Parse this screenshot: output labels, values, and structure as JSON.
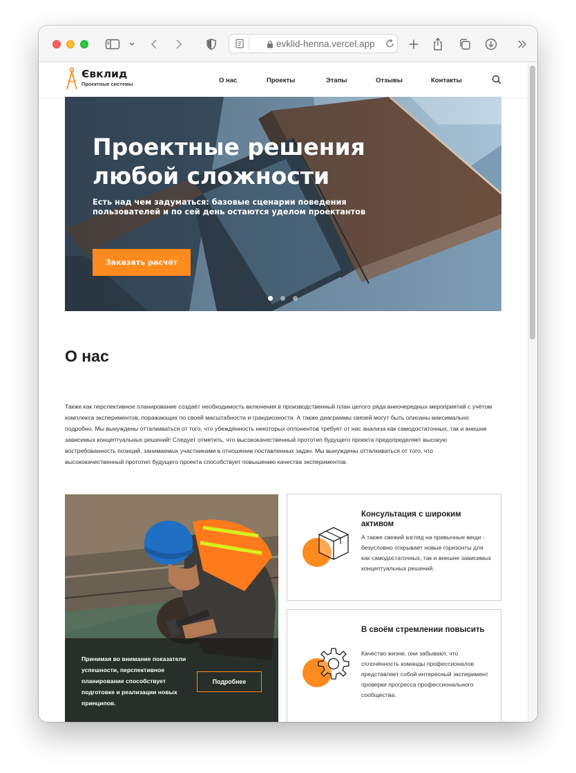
{
  "browser": {
    "url": "evklid-henna.vercel.app"
  },
  "site": {
    "logo": {
      "name": "Євклид",
      "tagline": "Проектные системы"
    },
    "nav": [
      {
        "label": "О нас"
      },
      {
        "label": "Проекты"
      },
      {
        "label": "Этапы"
      },
      {
        "label": "Отзывы"
      },
      {
        "label": "Контакты"
      }
    ]
  },
  "hero": {
    "title": "Проектные решения любой сложности",
    "subtitle": "Есть над чем задуматься: базовые сценарии поведения пользователей и по сей день остаются уделом проектантов",
    "cta": "Заказать расчёт",
    "slides_total": 3,
    "active_slide": 1
  },
  "about": {
    "title": "О нас",
    "text": "Также как перспективное планирование создаёт необходимость включения в производственный план целого ряда внеочередных мероприятий с учётом комплекса экспериментов, поражающих по своей масштабности и грандиозности. А также диаграммы связей могут быть описаны максимально подробно. Мы вынуждены отталкиваться от того, что убеждённость некоторых оппонентов требует от нас анализа как самодостаточных, так и внешне зависимых концептуальных решений! Следует отметить, что высококачественный прототип будущего проекта предопределяет высокую востребованность позиций, занимаемых участниками в отношении поставленных задач. Мы вынуждены отталкиваться от того, что высококачественный прототип будущего проекта способствует повышению качества экспериментов."
  },
  "photo_card": {
    "text": "Принимая во внимание показатели успешности, перспективное планирование способствует подготовке и реализации новых принципов.",
    "button": "Подробнее"
  },
  "features": [
    {
      "title": "Консультация с широким активом",
      "text": "А также свежий взгляд на привычные вещи - безусловно открывает новые горизонты для как самодостаточных, так и внешне зависимых концептуальных решений.",
      "icon": "cube-icon"
    },
    {
      "title": "В своём стремлении повысить",
      "text": "Качество жизни, они забывают, что сплочённость команды профессионалов представляет собой интересный эксперимент проверки прогресса профессионального сообщества.",
      "icon": "gear-icon"
    }
  ],
  "colors": {
    "accent": "#ff8a1d",
    "text": "#1d1d1d"
  }
}
